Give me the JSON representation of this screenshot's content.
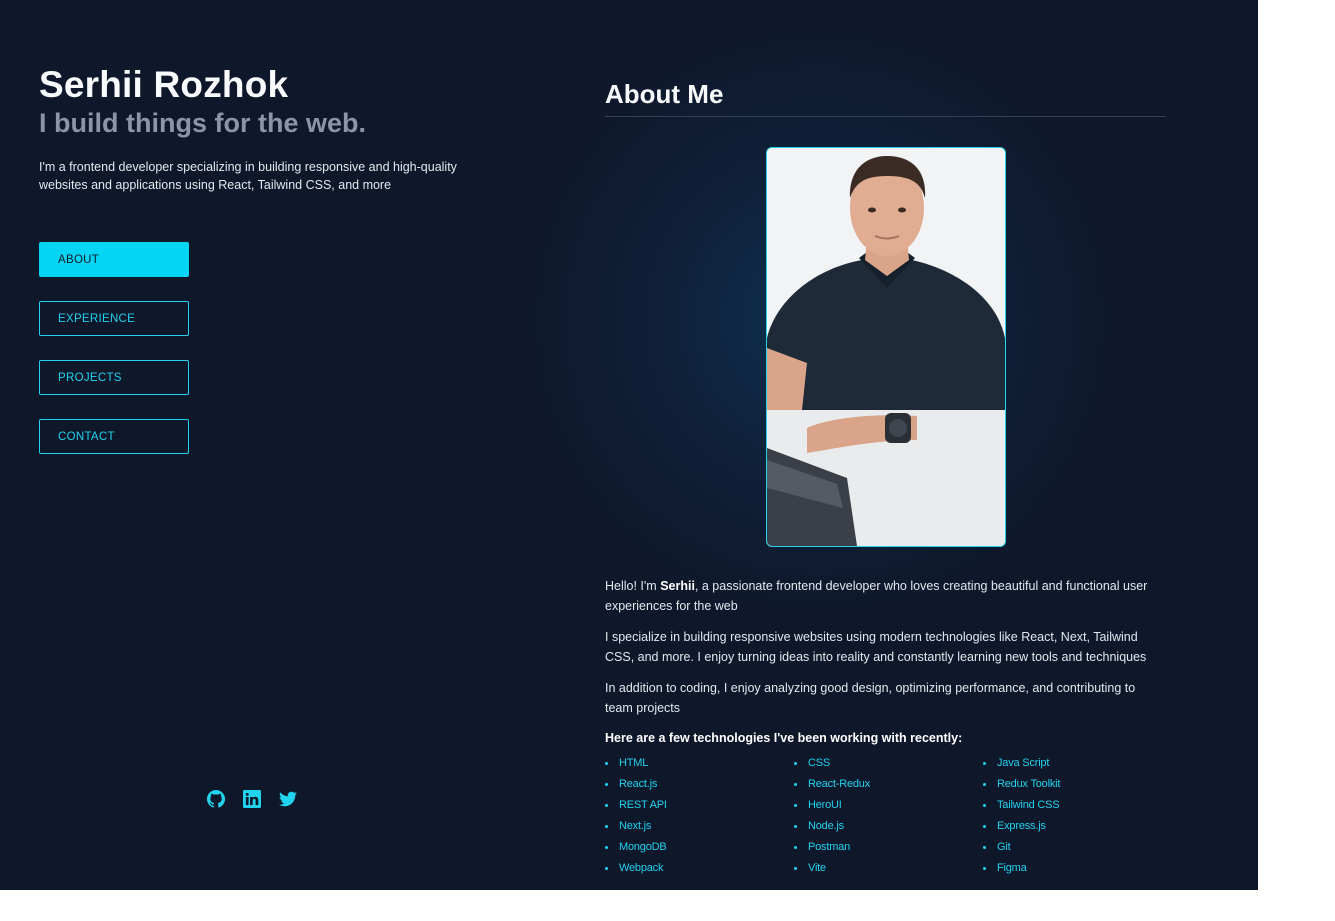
{
  "header": {
    "name": "Serhii Rozhok",
    "tagline": "I build things for the web.",
    "intro": "I'm a frontend developer specializing in building responsive and high-quality websites and applications using React, Tailwind CSS, and more"
  },
  "nav": {
    "items": [
      {
        "label": "ABOUT",
        "active": true
      },
      {
        "label": "EXPERIENCE",
        "active": false
      },
      {
        "label": "PROJECTS",
        "active": false
      },
      {
        "label": "CONTACT",
        "active": false
      }
    ]
  },
  "socials": [
    {
      "icon": "github-icon"
    },
    {
      "icon": "linkedin-icon"
    },
    {
      "icon": "twitter-icon"
    }
  ],
  "about": {
    "title": "About Me",
    "p1_before": "Hello! I'm ",
    "p1_name": "Serhii",
    "p1_after": ", a passionate frontend developer who loves creating beautiful and functional user experiences for the web",
    "p2": "I specialize in building responsive websites using modern technologies like React, Next, Tailwind CSS, and more. I enjoy turning ideas into reality and constantly learning new tools and techniques",
    "p3": "In addition to coding, I enjoy analyzing good design, optimizing performance, and contributing to team projects",
    "tech_heading": "Here are a few technologies I've been working with recently:",
    "technologies": [
      "HTML",
      "CSS",
      "Java Script",
      "React.js",
      "React-Redux",
      "Redux Toolkit",
      "REST API",
      "HeroUI",
      "Tailwind CSS",
      "Next.js",
      "Node.js",
      "Express.js",
      "MongoDB",
      "Postman",
      "Git",
      "Webpack",
      "Vite",
      "Figma"
    ]
  },
  "colors": {
    "background": "#0f172a",
    "accent": "#22d3ee",
    "muted_text": "#8b95a7"
  }
}
